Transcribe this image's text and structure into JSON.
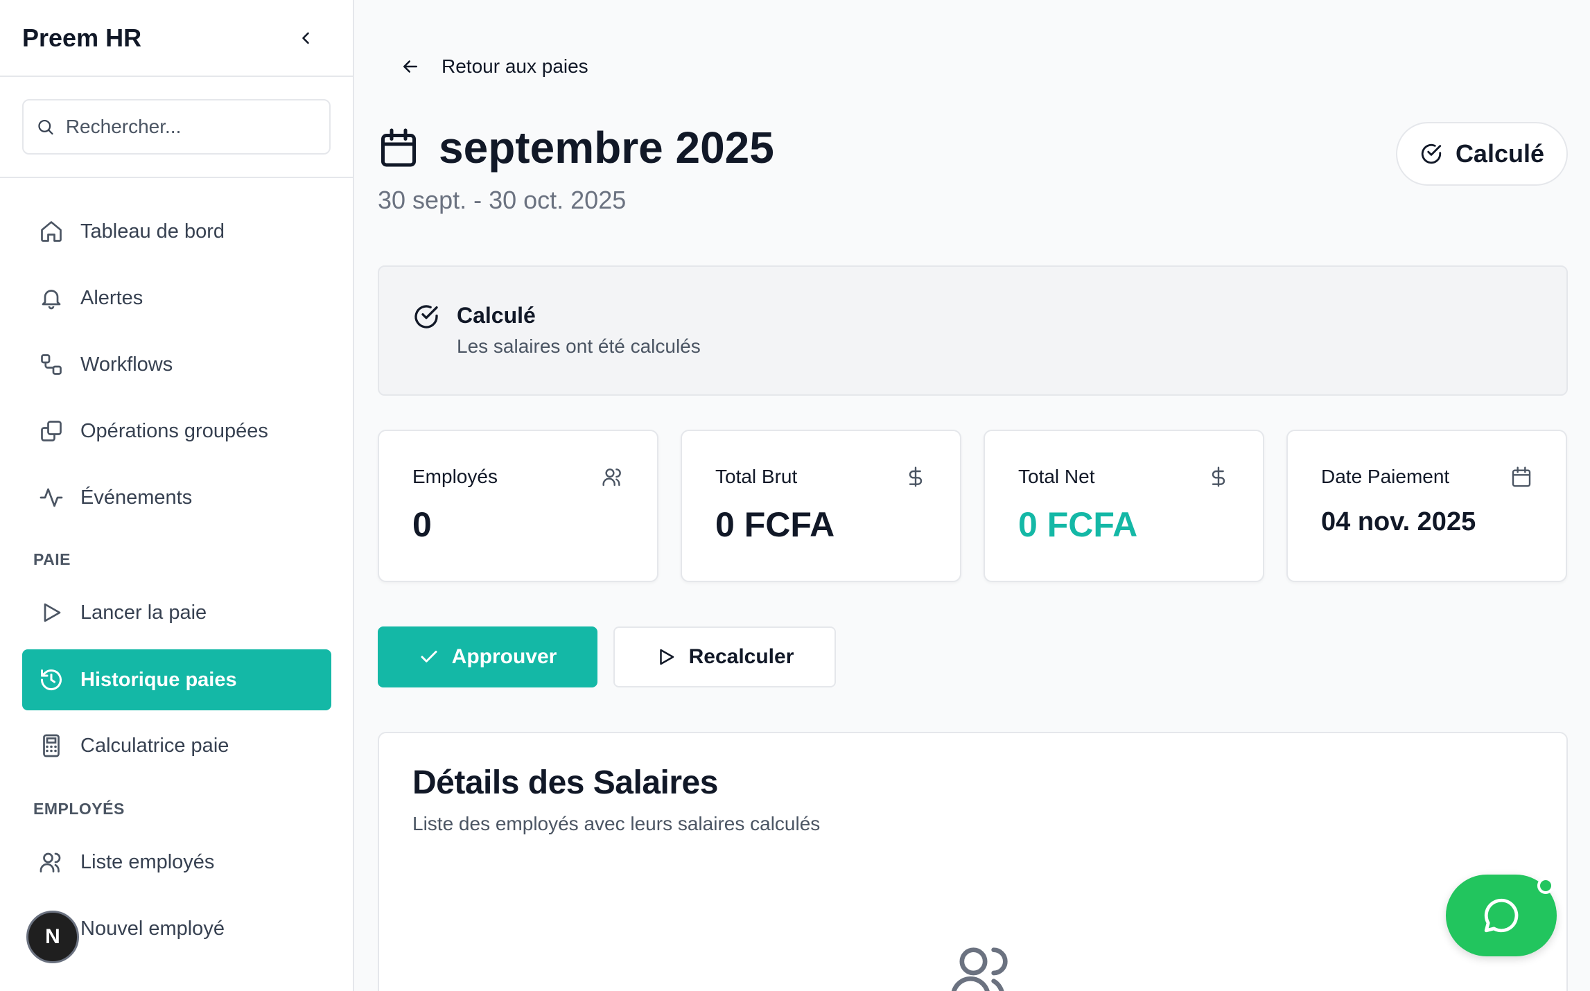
{
  "sidebar": {
    "brand": "Preem HR",
    "search_placeholder": "Rechercher...",
    "items": [
      {
        "label": "Tableau de bord",
        "icon": "home-icon"
      },
      {
        "label": "Alertes",
        "icon": "bell-icon"
      },
      {
        "label": "Workflows",
        "icon": "workflow-icon"
      },
      {
        "label": "Opérations groupées",
        "icon": "copy-icon"
      },
      {
        "label": "Événements",
        "icon": "activity-icon"
      }
    ],
    "section_paie": "PAIE",
    "paie_items": [
      {
        "label": "Lancer la paie",
        "icon": "play-icon"
      },
      {
        "label": "Historique paies",
        "icon": "history-icon",
        "active": true
      },
      {
        "label": "Calculatrice paie",
        "icon": "calculator-icon"
      }
    ],
    "section_employes": "EMPLOYÉS",
    "employes_items": [
      {
        "label": "Liste employés",
        "icon": "users-icon"
      },
      {
        "label": "Nouvel employé",
        "icon": "user-plus-icon"
      }
    ],
    "avatar_letter": "N"
  },
  "main": {
    "back_label": "Retour aux paies",
    "title": "septembre 2025",
    "period": "30 sept. - 30 oct. 2025",
    "status_pill": "Calculé",
    "notice": {
      "title": "Calculé",
      "description": "Les salaires ont été calculés"
    },
    "cards": [
      {
        "label": "Employés",
        "value": "0",
        "icon": "users-icon"
      },
      {
        "label": "Total Brut",
        "value": "0 FCFA",
        "icon": "dollar-icon"
      },
      {
        "label": "Total Net",
        "value": "0 FCFA",
        "icon": "dollar-icon"
      },
      {
        "label": "Date Paiement",
        "value": "04 nov. 2025",
        "icon": "calendar-icon"
      }
    ],
    "approve_label": "Approuver",
    "recalc_label": "Recalculer",
    "details": {
      "title": "Détails des Salaires",
      "description": "Liste des employés avec leurs salaires calculés"
    }
  },
  "colors": {
    "accent": "#14b8a6",
    "chat_green": "#22c55e"
  }
}
